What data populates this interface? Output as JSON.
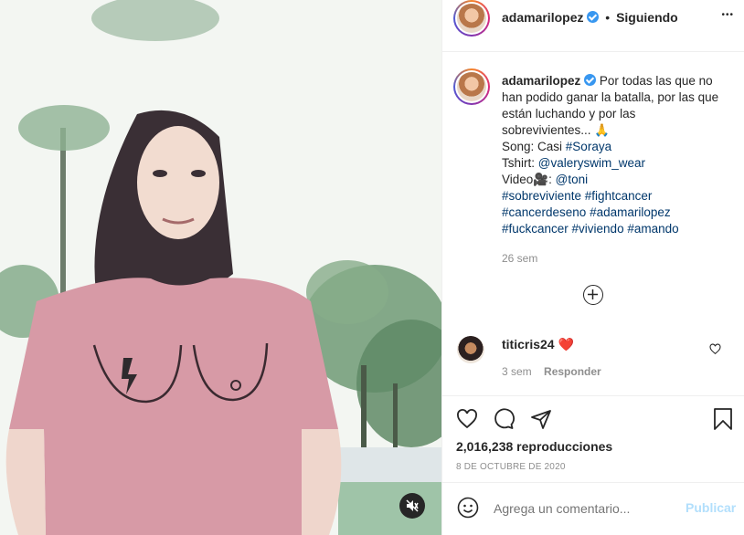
{
  "post": {
    "username": "adamarilopez",
    "follow_sep": "•",
    "follow_status": "Siguiendo",
    "more": "•••"
  },
  "caption": {
    "username": "adamarilopez",
    "text1": "Por todas las que no han podido ganar la batalla, por las que están luchando y por las sobrevivientes... 🙏",
    "song_prefix": "Song: Casi ",
    "song_tag": "#Soraya",
    "tshirt_prefix": "Tshirt: ",
    "tshirt_tag": "@valeryswim_wear",
    "video_prefix": "Video🎥: ",
    "video_tag": "@toni",
    "tags_line1": "#sobreviviente #fightcancer",
    "tags_line2": "#cancerdeseno #adamarilopez",
    "tags_line3": "#fuckcancer #viviendo #amando",
    "age": "26 sem"
  },
  "comment": {
    "username": "titicris24",
    "heart": "❤️",
    "age": "3 sem",
    "reply": "Responder"
  },
  "stats": {
    "views": "2,016,238 reproducciones",
    "date": "8 DE OCTUBRE DE 2020"
  },
  "add_comment": {
    "placeholder": "Agrega un comentario...",
    "publish": "Publicar"
  },
  "colors": {
    "accent_blue": "#0095f6",
    "link": "#00376b",
    "muted": "#8e8e8e",
    "heart_red": "#ed4956",
    "shirt_pink": "#d79aa6"
  }
}
